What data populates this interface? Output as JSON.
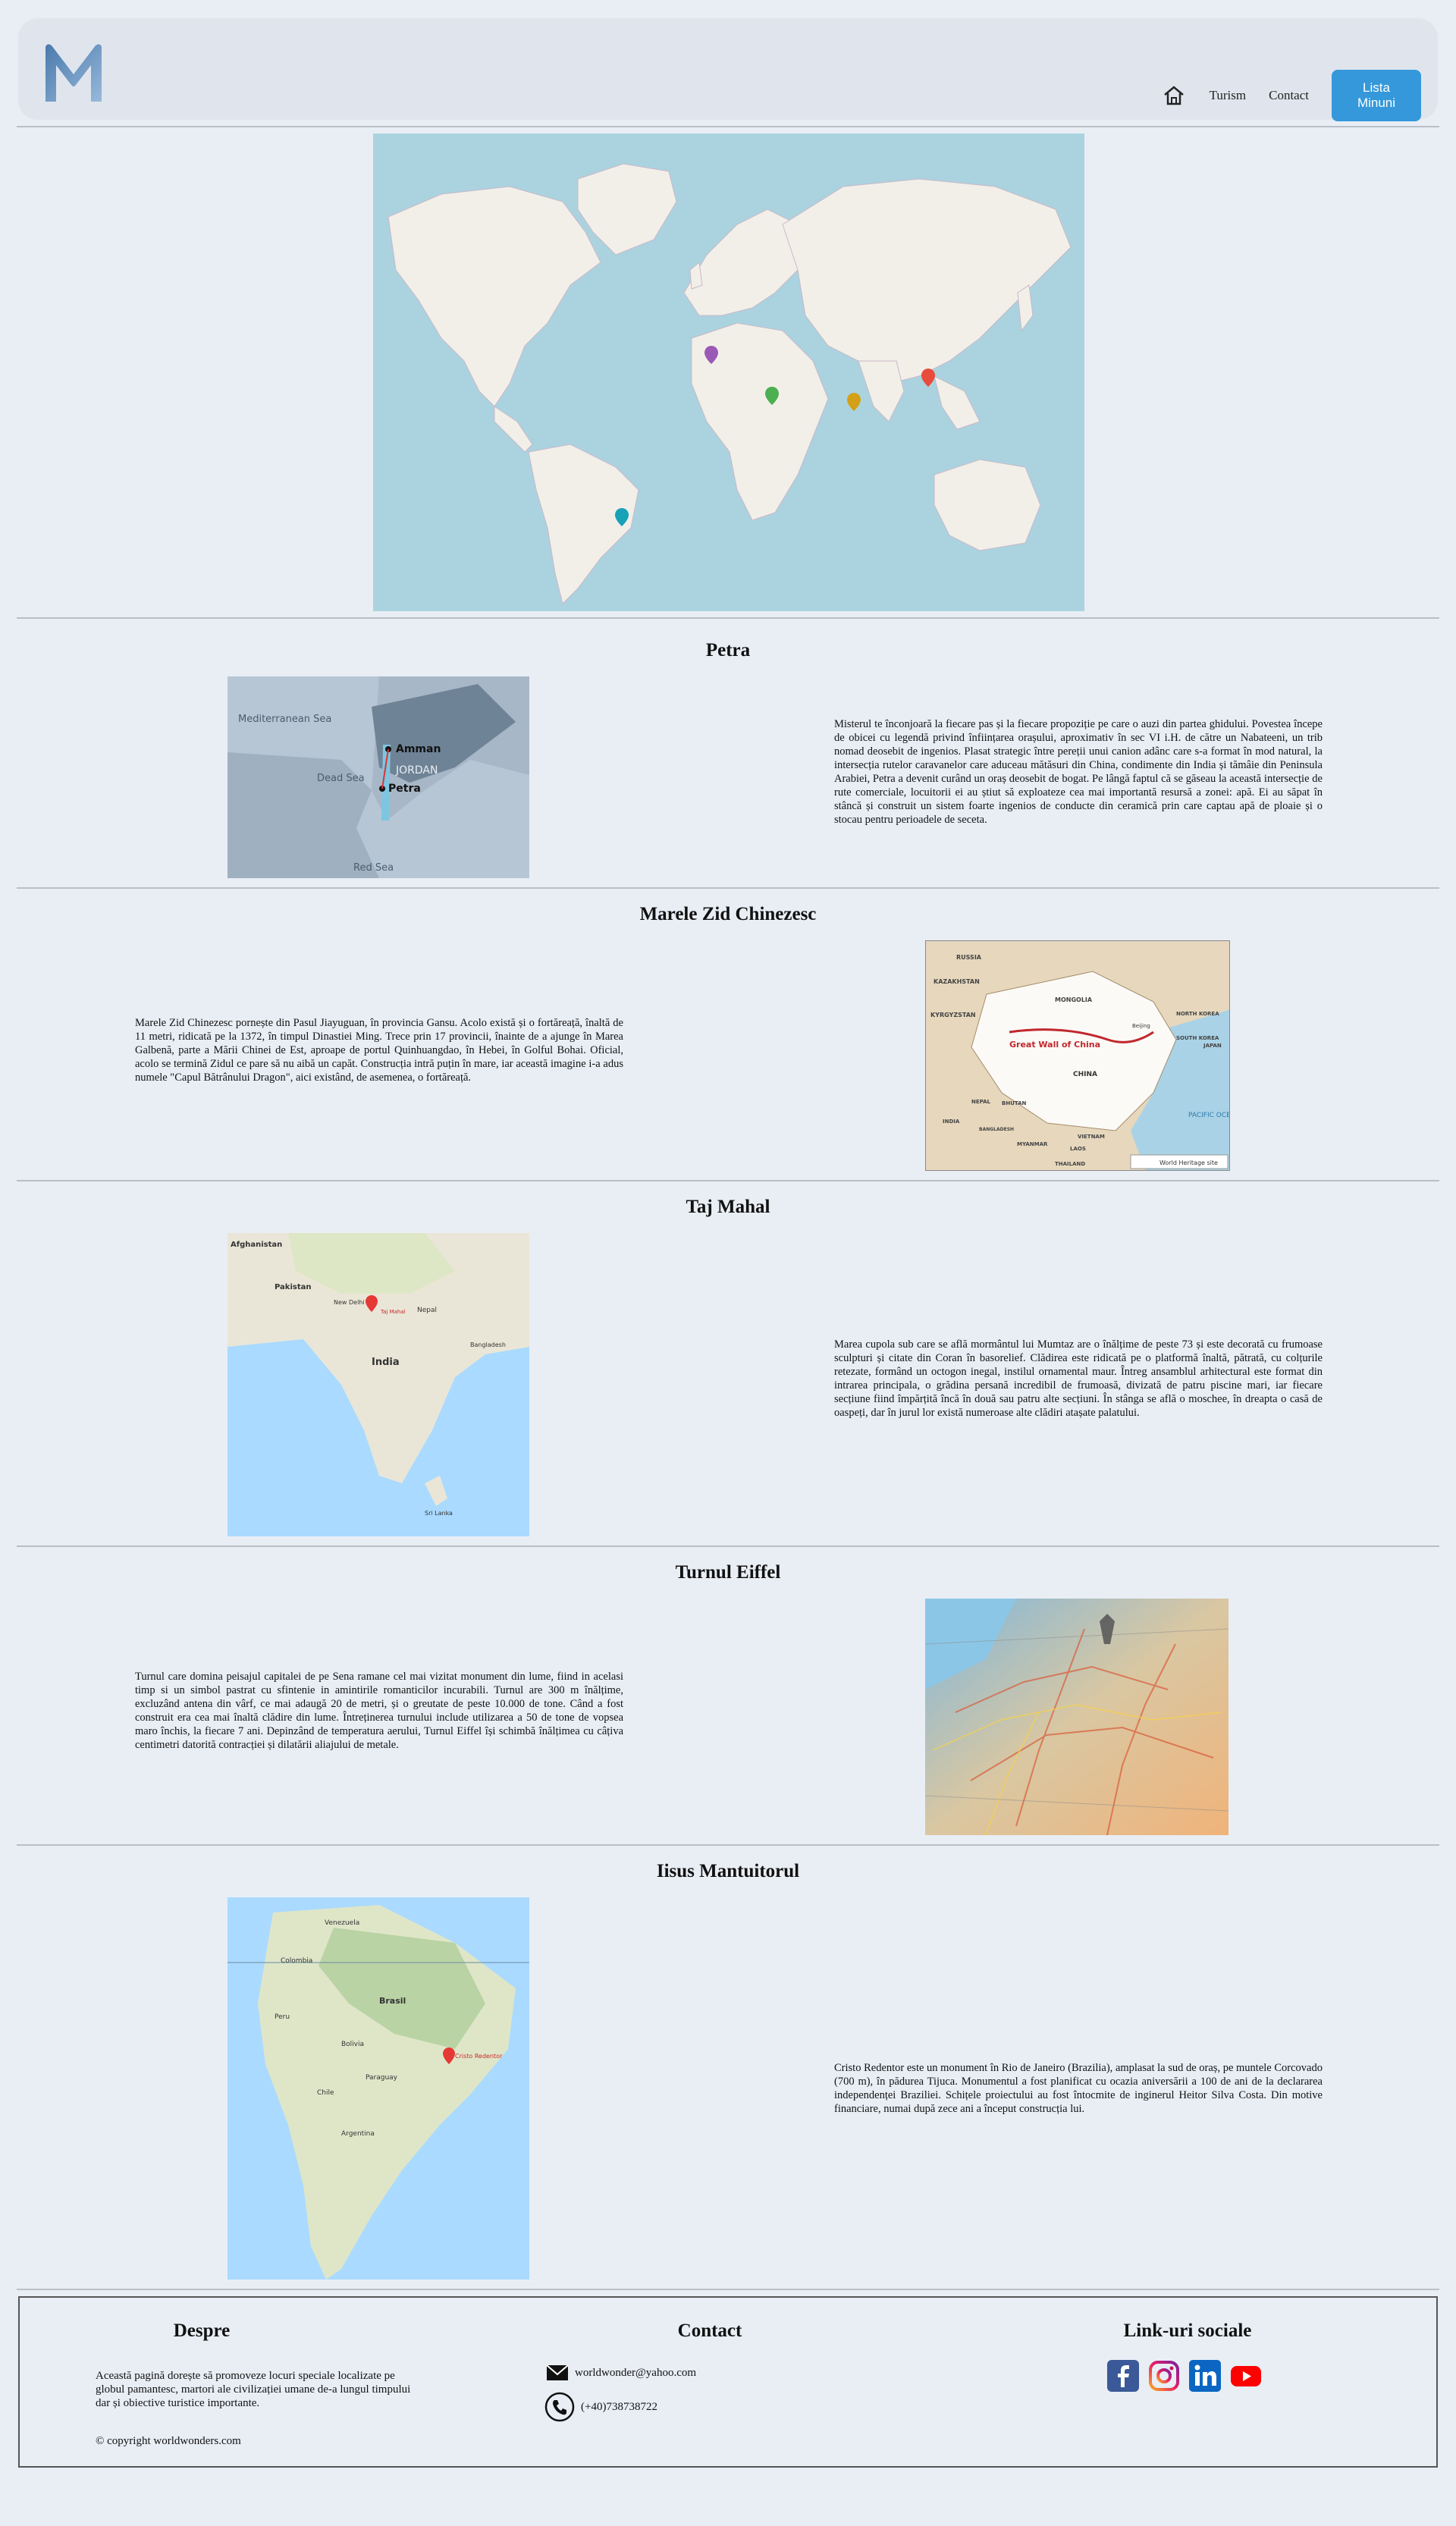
{
  "nav": {
    "links": [
      "Turism",
      "Contact"
    ],
    "button": "Lista Minuni",
    "home_icon": "home-icon",
    "logo_icon": "m-logo"
  },
  "sections": [
    {
      "title": "Petra",
      "text": "Misterul te înconjoară la fiecare pas și la fiecare propoziție pe care o auzi din partea ghidului. Povestea începe de obicei cu legendă privind înființarea orașului, aproximativ în sec VI i.H. de către un Nabateeni, un trib nomad deosebit de ingenios. Plasat strategic între pereții unui canion adânc care s-a format în mod natural, la intersecția rutelor caravanelor care aduceau mătăsuri din China, condimente din India și tămâie din Peninsula Arabiei, Petra a devenit curând un oraș deosebit de bogat. Pe lângă faptul că se găseau la această intersecție de rute comerciale, locuitorii ei au știut să exploateze cea mai importantă resursă a zonei: apă. Ei au săpat în stâncă și construit un sistem foarte ingenios de conducte din ceramică prin care captau apă de ploaie și o stocau pentru perioadele de seceta.",
      "map_labels": [
        "Mediterranean Sea",
        "Dead Sea",
        "Amman",
        "JORDAN",
        "Petra",
        "Red Sea"
      ]
    },
    {
      "title": "Marele Zid Chinezesc",
      "text": "Marele Zid Chinezesc pornește din Pasul Jiayuguan, în provincia Gansu. Acolo există și o fortăreață, înaltă de 11 metri, ridicată pe la 1372, în timpul Dinastiei Ming. Trece prin 17 provincii, înainte de a ajunge în Marea Galbenă, parte a Mării Chinei de Est, aproape de portul Quinhuangdao, în Hebei, în Golful Bohai. Oficial, acolo se termină Zidul ce pare să nu aibă un capăt. Construcția intră puțin în mare, iar această imagine i-a adus numele \"Capul Bătrânului Dragon\", aici existând, de asemenea, o fortăreață.",
      "map_labels": [
        "RUSSIA",
        "KAZAKHSTAN",
        "MONGOLIA",
        "KYRGYZSTAN",
        "NORTH KOREA",
        "SOUTH KOREA",
        "JAPAN",
        "Great Wall of China",
        "CHINA",
        "Beijing",
        "NEPAL",
        "BHUTAN",
        "INDIA",
        "BANGLADESH",
        "MYANMAR",
        "LAOS",
        "VIETNAM",
        "THAILAND",
        "PACIFIC OCEAN",
        "World Heritage site"
      ]
    },
    {
      "title": "Taj Mahal",
      "text": "Marea cupola sub care se află mormântul lui Mumtaz are o înălțime de peste 73 și este decorată cu frumoase sculpturi și citate din Coran în basorelief. Clădirea este ridicată pe o platformă înaltă, pătrată, cu colțurile retezate, formând un octogon inegal, instilul ornamental maur. Întreg ansamblul arhitectural este format din intrarea principala, o grădina persană incredibil de frumoasă, divizată de patru piscine mari, iar fiecare secțiune fiind împărțită încă în două sau patru alte secțiuni. În stânga se află o moschee, în dreapta o casă de oaspeți, dar în jurul lor există numeroase alte clădiri atașate palatului.",
      "map_labels": [
        "Afghanistan",
        "Pakistan",
        "New Delhi",
        "Taj Mahal",
        "Nepal",
        "India",
        "Bangladesh",
        "Sri Lanka"
      ]
    },
    {
      "title": "Turnul Eiffel",
      "text": "Turnul care domina peisajul capitalei de pe Sena ramane cel mai vizitat monument din lume, fiind in acelasi timp si un simbol pastrat cu sfintenie in amintirile romanticilor incurabili. Turnul are 300 m înălțime, excluzând antena din vârf, ce mai adaugă 20 de metri, și o greutate de peste 10.000 de tone. Când a fost construit era cea mai înaltă clădire din lume. Întreținerea turnului include utilizarea a 50 de tone de vopsea maro închis, la fiecare 7 ani. Depinzând de temperatura aerului, Turnul Eiffel își schimbă înălțimea cu câțiva centimetri datorită contracției și dilatării aliajului de metale."
    },
    {
      "title": "Iisus Mantuitorul",
      "text": "Cristo Redentor este un monument în Rio de Janeiro (Brazilia), amplasat la sud de oraș, pe muntele Corcovado (700 m), în pădurea Tijuca. Monumentul a fost planificat cu ocazia aniversării a 100 de ani de la declararea independenței Braziliei. Schițele proiectului au fost întocmite de inginerul Heitor Silva Costa. Din motive financiare, numai după zece ani a început construcția lui.",
      "map_labels": [
        "Venezuela",
        "Colombia",
        "Brasil",
        "Peru",
        "Bolivia",
        "Paraguay",
        "Chile",
        "Argentina",
        "Cristo Redentor"
      ]
    }
  ],
  "footer": {
    "about_title": "Despre",
    "about_text": "Această pagină dorește să promoveze locuri speciale localizate pe globul pamantesc, martori ale civilizației umane de-a lungul timpului dar și obiective turistice importante.",
    "copyright": "© copyright worldwonders.com",
    "contact_title": "Contact",
    "email": "worldwonder@yahoo.com",
    "phone": "(+40)738738722",
    "social_title": "Link-uri sociale",
    "social_icons": [
      "facebook-icon",
      "instagram-icon",
      "linkedin-icon",
      "youtube-icon"
    ],
    "colors": {
      "facebook": "#3b5998",
      "linkedin": "#0a66c2",
      "youtube": "#ff0000"
    }
  }
}
